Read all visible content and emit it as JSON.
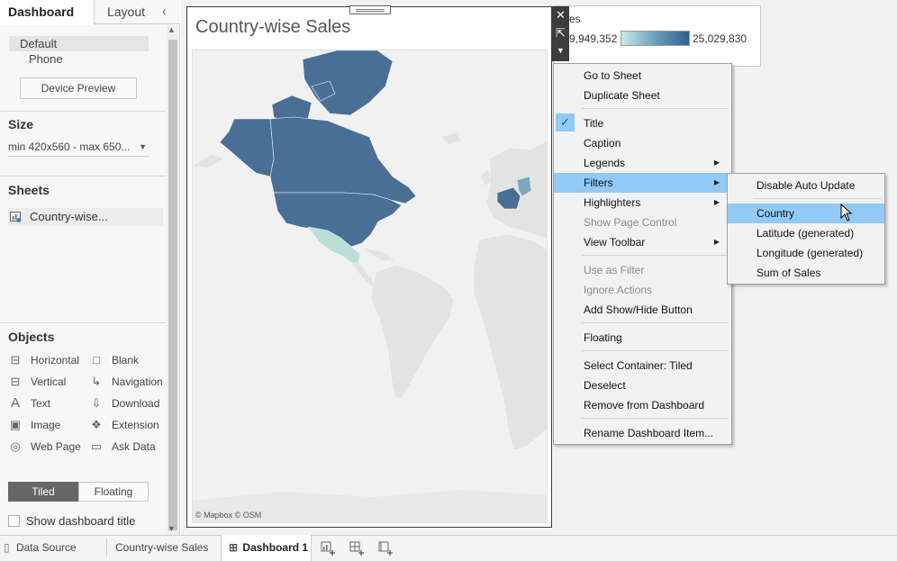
{
  "left_pane": {
    "tabs": [
      "Dashboard",
      "Layout"
    ],
    "devices": {
      "default": "Default",
      "phone": "Phone",
      "preview_button": "Device Preview"
    },
    "size": {
      "heading": "Size",
      "value": "min 420x560 - max 650..."
    },
    "sheets": {
      "heading": "Sheets",
      "items": [
        "Country-wise..."
      ]
    },
    "objects": {
      "heading": "Objects",
      "items": [
        {
          "label": "Horizontal",
          "icon": "horizontal-container-icon"
        },
        {
          "label": "Blank",
          "icon": "blank-icon"
        },
        {
          "label": "Vertical",
          "icon": "vertical-container-icon"
        },
        {
          "label": "Navigation",
          "icon": "navigation-icon"
        },
        {
          "label": "Text",
          "icon": "text-icon"
        },
        {
          "label": "Download",
          "icon": "download-icon"
        },
        {
          "label": "Image",
          "icon": "image-icon"
        },
        {
          "label": "Extension",
          "icon": "extension-icon"
        },
        {
          "label": "Web Page",
          "icon": "web-page-icon"
        },
        {
          "label": "Ask Data",
          "icon": "ask-data-icon"
        }
      ]
    },
    "layout_mode": {
      "tiled": "Tiled",
      "floating": "Floating"
    },
    "show_dashboard_title": "Show dashboard title"
  },
  "zone": {
    "title": "Country-wise Sales",
    "map_credit": "© Mapbox © OSM"
  },
  "legend": {
    "title": "es",
    "min": "9,949,352",
    "max": "25,029,830"
  },
  "context_menu": {
    "items": [
      {
        "label": "Go to Sheet"
      },
      {
        "label": "Duplicate Sheet"
      },
      {
        "label": "Title",
        "checked": true
      },
      {
        "label": "Caption"
      },
      {
        "label": "Legends",
        "submenu": true
      },
      {
        "label": "Filters",
        "submenu": true,
        "highlighted": true
      },
      {
        "label": "Highlighters",
        "submenu": true
      },
      {
        "label": "Show Page Control",
        "disabled": true
      },
      {
        "label": "View Toolbar",
        "submenu": true
      },
      {
        "label": "Use as Filter",
        "disabled": true
      },
      {
        "label": "Ignore Actions",
        "disabled": true
      },
      {
        "label": "Add Show/Hide Button"
      },
      {
        "label": "Floating"
      },
      {
        "label": "Select Container: Tiled"
      },
      {
        "label": "Deselect"
      },
      {
        "label": "Remove from Dashboard"
      },
      {
        "label": "Rename Dashboard Item..."
      }
    ]
  },
  "filters_submenu": {
    "items": [
      {
        "label": "Disable Auto Update"
      },
      {
        "label": "Country",
        "highlighted": true
      },
      {
        "label": "Latitude (generated)"
      },
      {
        "label": "Longitude (generated)"
      },
      {
        "label": "Sum of Sales"
      }
    ]
  },
  "bottom_tabs": [
    {
      "label": "Data Source",
      "icon": "database-icon"
    },
    {
      "label": "Country-wise Sales"
    },
    {
      "label": "Dashboard 1",
      "active": true,
      "icon": "dashboard-icon"
    }
  ],
  "colors": {
    "menu_highlight": "#91c9f7",
    "map_dark": "#4a6f96",
    "map_light": "#b9e0d8",
    "tiled_active": "#666666"
  }
}
